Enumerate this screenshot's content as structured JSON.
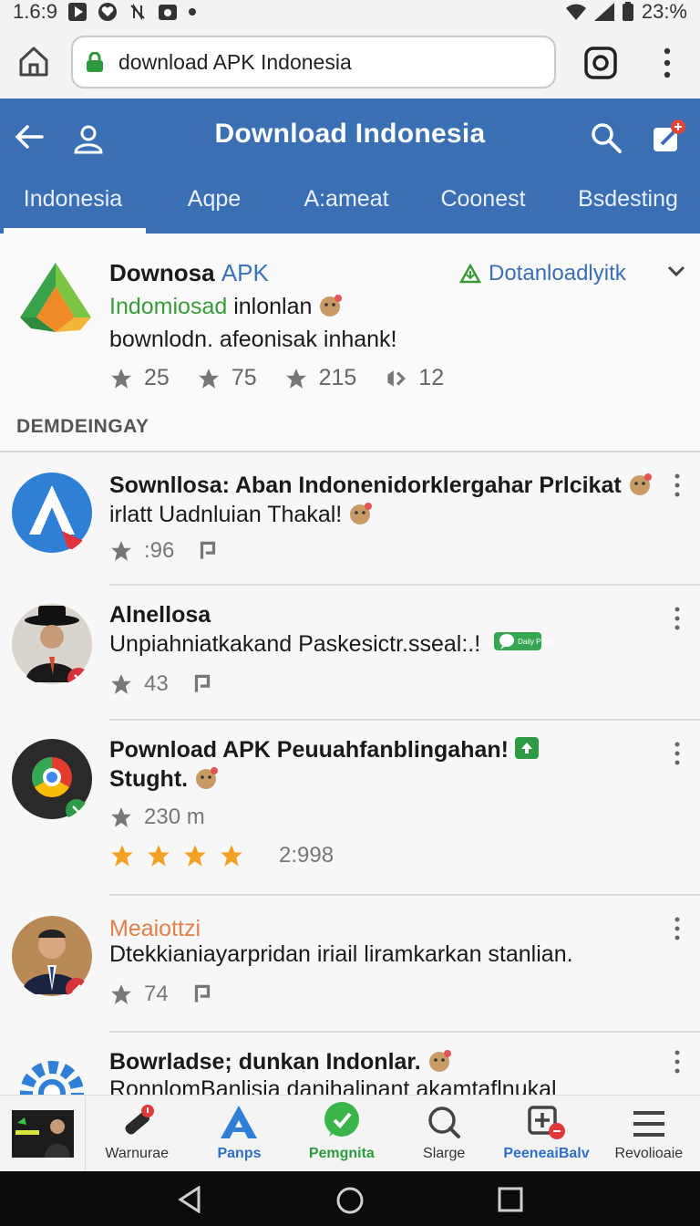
{
  "status": {
    "time": "1.6:9",
    "battery": "23:%"
  },
  "browser": {
    "url": "download APK Indonesia"
  },
  "appbar": {
    "title": "Download Indonesia",
    "tabs": [
      "Indonesia",
      "Aqpe",
      "A:ameat",
      "Coonest",
      "Bsdesting"
    ]
  },
  "hero": {
    "title_bold": "Downosa",
    "title_blue": "APK",
    "download_label": "Dotanloadlyitk",
    "sub_green": "Indomiosad",
    "sub_rest": "inlonlan",
    "desc": "bownlodn. afeonisak inhank!",
    "stats": [
      "25",
      "75",
      "215",
      "12"
    ],
    "section_label": "DEMDEINGAY"
  },
  "posts": [
    {
      "title": "Sownllosa: Aban Indonenidorklergahar Prlcikat",
      "body": "irlatt Uadnluian Thakal!",
      "stat": ":96"
    },
    {
      "title": "Alnellosa",
      "body": "Unpiahniatkakand Paskesictr.sseal:.!",
      "stat": "43",
      "badge": "Daily Press"
    },
    {
      "title": "Pownload APK Peuuahfanblingahan!",
      "body": "Stught.",
      "stat": "230 m",
      "rating_count": "2:998"
    },
    {
      "author": "Meaiottzi",
      "body": "Dtekkianiayarpridan iriail liramkarkan stanlian.",
      "stat": "74"
    },
    {
      "title": "Bowrladse; dunkan Indonlar.",
      "body": "RonnlomBanlisia danihalinant akamtaflnukal"
    }
  ],
  "bottomnav": [
    "Warnurae",
    "Panps",
    "Pemgnita",
    "Slarge",
    "PeeneaiBalv",
    "Revolioaie"
  ],
  "colors": {
    "appbar": "#3b6fb3",
    "accent_green": "#3a9a3a",
    "accent_blue": "#3a6fb5",
    "author_orange": "#e0804a"
  }
}
